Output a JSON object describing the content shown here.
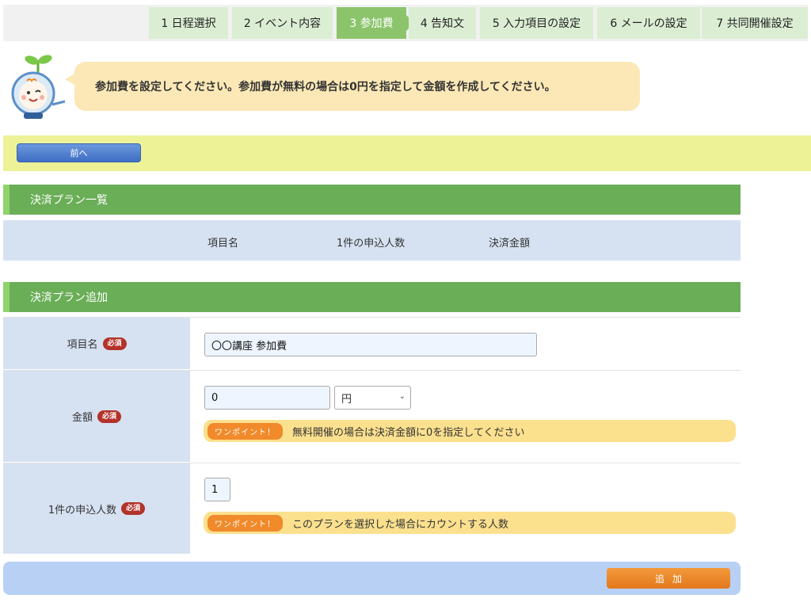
{
  "steps": [
    {
      "label": "1 日程選択"
    },
    {
      "label": "2 イベント内容"
    },
    {
      "label": "3 参加費"
    },
    {
      "label": "4 告知文"
    },
    {
      "label": "5 入力項目の設定"
    },
    {
      "label": "6 メールの設定"
    },
    {
      "label": "7 共同開催設定"
    }
  ],
  "active_step": 2,
  "message": "参加費を設定してください。参加費が無料の場合は0円を指定して金額を作成してください。",
  "back_label": "前へ",
  "plan_list": {
    "title": "決済プラン一覧",
    "columns": [
      "項目名",
      "1件の申込人数",
      "決済金額"
    ]
  },
  "plan_add": {
    "title": "決済プラン追加",
    "required_label": "必須",
    "item_name": {
      "label": "項目名",
      "value": "〇〇講座 参加費"
    },
    "amount": {
      "label": "金額",
      "value": "0",
      "currency": "円",
      "tip_badge": "ワンポイント！",
      "tip_text": "無料開催の場合は決済金額に0を指定してください"
    },
    "applicants": {
      "label": "1件の申込人数",
      "value": "1",
      "tip_badge": "ワンポイント！",
      "tip_text": "このプランを選択した場合にカウントする人数"
    },
    "add_label": "追加"
  },
  "colors": {
    "section_header": "#6aae57",
    "active_step": "#8cc46c",
    "back_bar": "#edf297",
    "add_button": "#e4781c",
    "required_badge": "#b3322a"
  }
}
